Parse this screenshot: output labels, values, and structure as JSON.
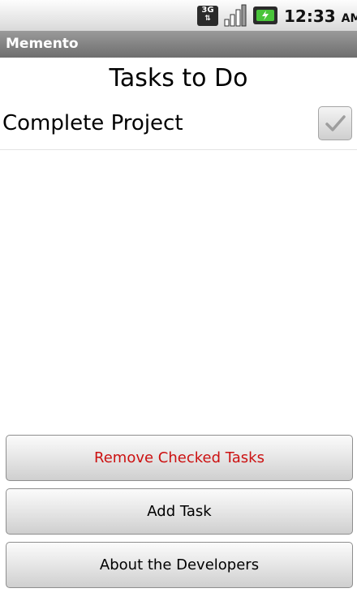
{
  "status_bar": {
    "network_badge": "3G",
    "network_arrows": "⇅",
    "signal_icon": "signal-bars-icon",
    "battery_icon": "battery-charging-icon",
    "time": "12:33",
    "ampm": "AM"
  },
  "app": {
    "title": "Memento"
  },
  "main": {
    "heading": "Tasks to Do",
    "tasks": [
      {
        "label": "Complete Project",
        "checked": true
      }
    ]
  },
  "buttons": {
    "remove_checked": "Remove Checked Tasks",
    "add_task": "Add Task",
    "about": "About the Developers"
  },
  "colors": {
    "remove_text": "#cc1111",
    "title_bar": "#7a7a7a"
  }
}
